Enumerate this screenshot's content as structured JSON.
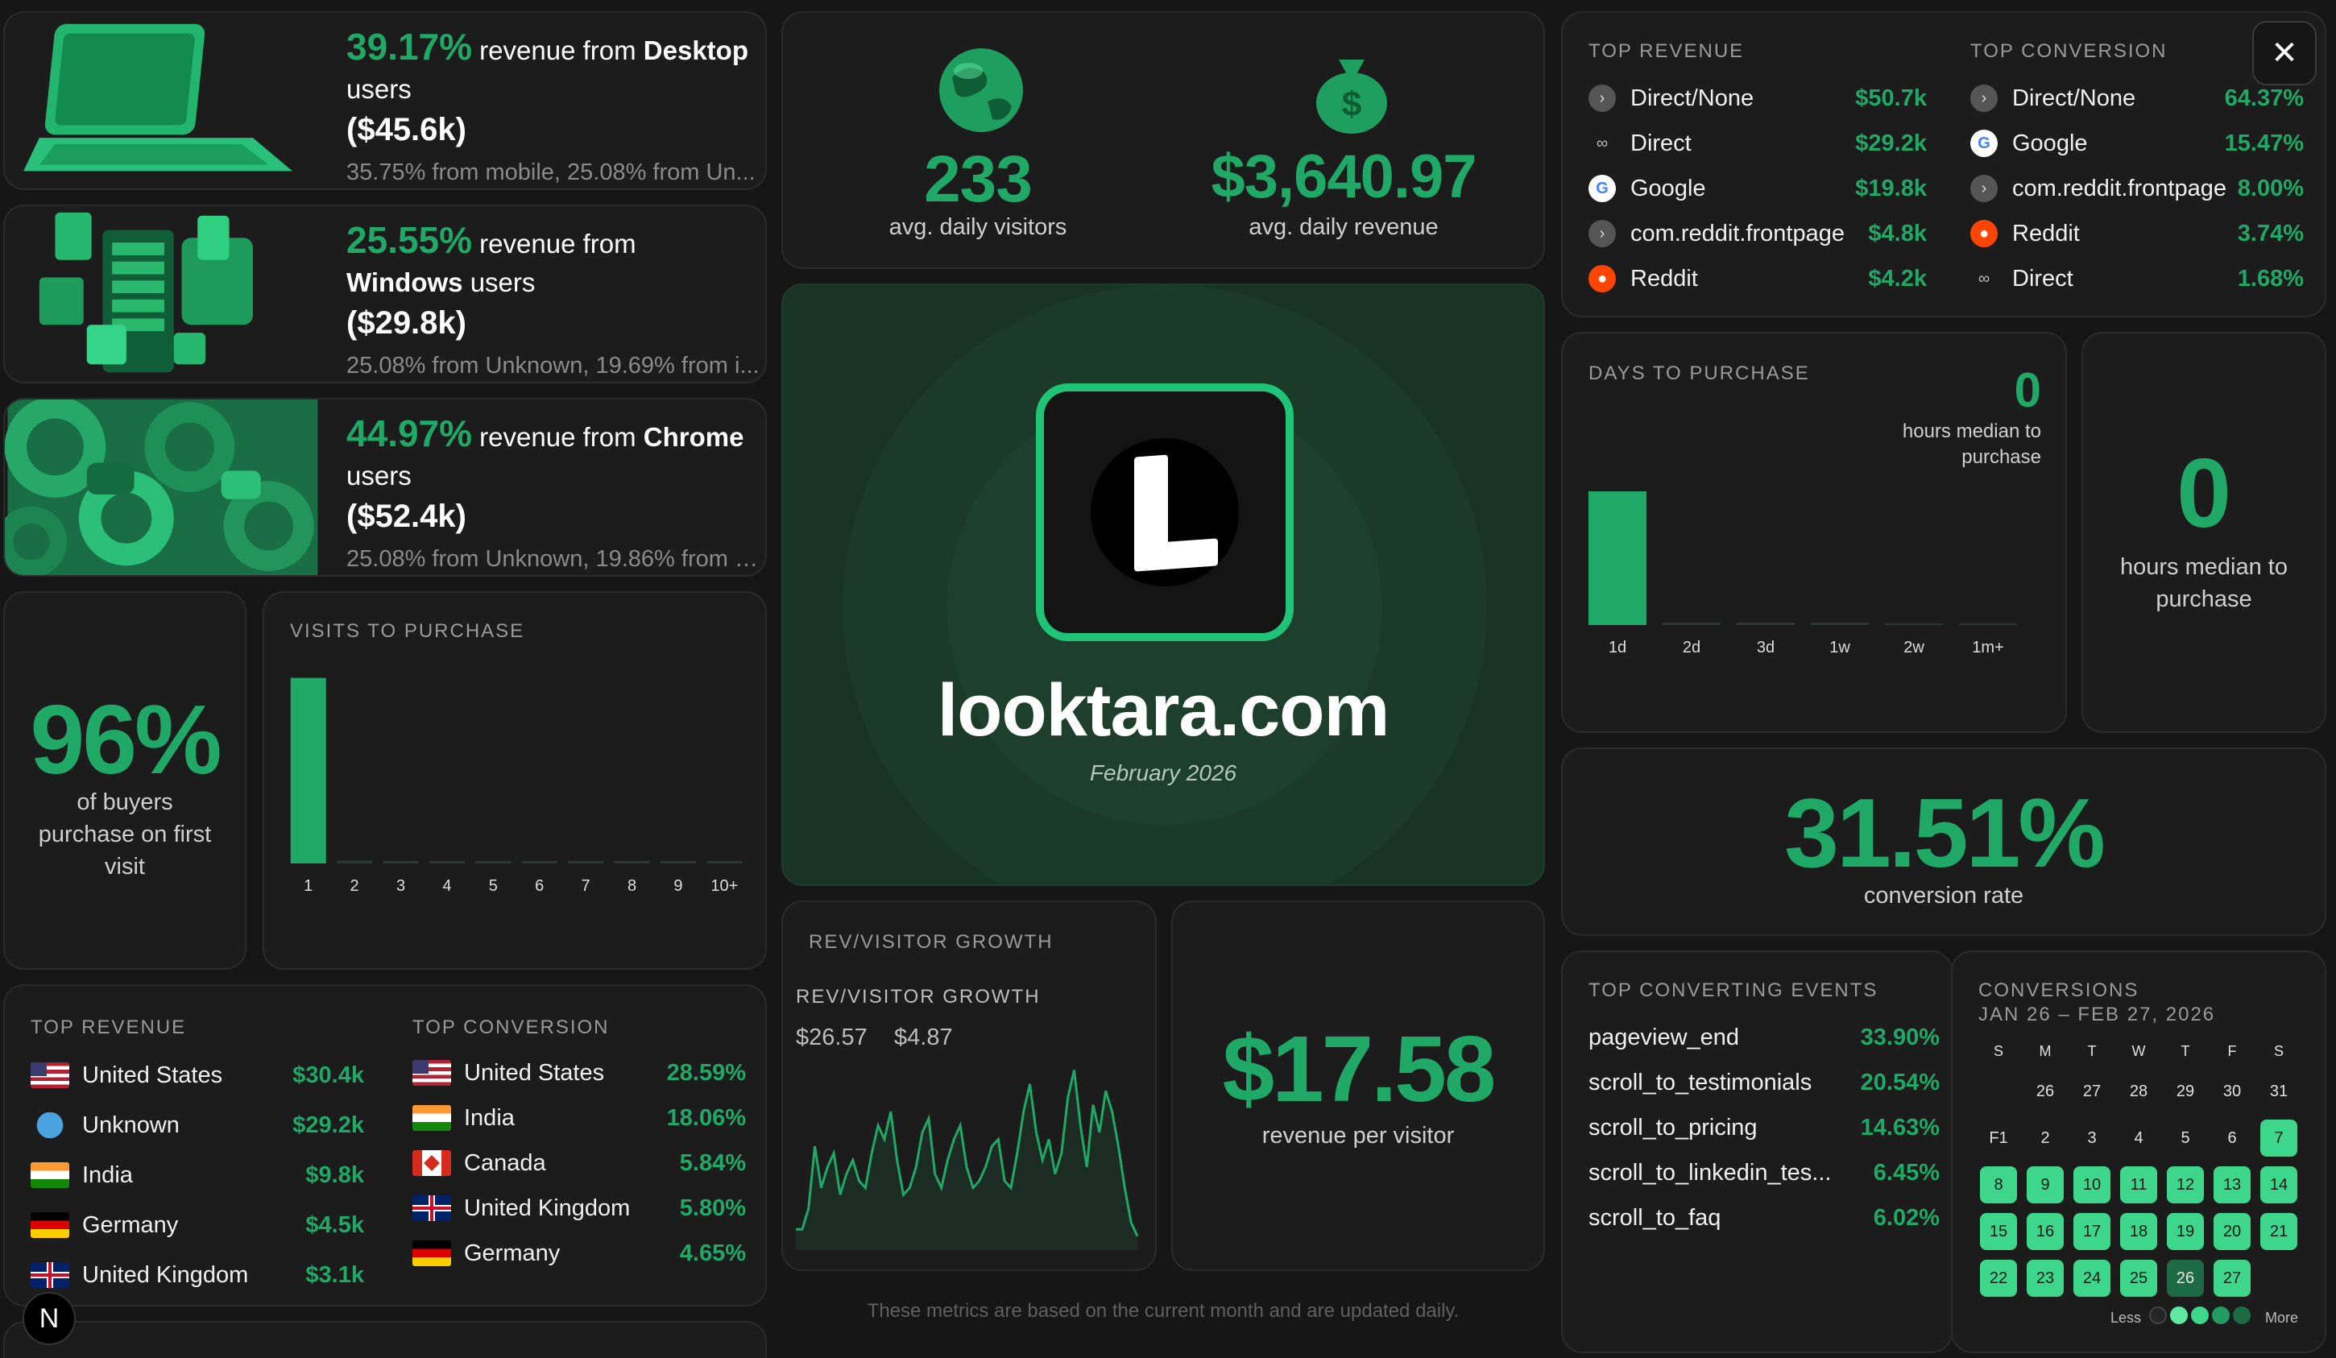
{
  "insights": [
    {
      "pct": "39.17%",
      "pre": " revenue from ",
      "strong": "Desktop",
      "post": " users",
      "amount": "($45.6k)",
      "sub": "35.75% from mobile, 25.08% from Un..."
    },
    {
      "pct": "25.55%",
      "pre": " revenue from ",
      "strong": "Windows",
      "post": " users",
      "amount": "($29.8k)",
      "sub": "25.08% from Unknown, 19.69% from i..."
    },
    {
      "pct": "44.97%",
      "pre": " revenue from ",
      "strong": "Chrome",
      "post": " users",
      "amount": "($52.4k)",
      "sub": "25.08% from Unknown, 19.86% from s..."
    }
  ],
  "stats": {
    "visitors_value": "233",
    "visitors_label": "avg. daily visitors",
    "revenue_value": "$3,640.97",
    "revenue_label": "avg. daily revenue"
  },
  "hero": {
    "domain": "looktara.com",
    "period": "February 2026"
  },
  "sources": {
    "rev_title": "TOP REVENUE",
    "conv_title": "TOP CONVERSION",
    "revenue": [
      {
        "icon": "direct-icon",
        "name": "Direct/None",
        "value": "$50.7k"
      },
      {
        "icon": "link-icon",
        "name": "Direct",
        "value": "$29.2k"
      },
      {
        "icon": "google-icon",
        "name": "Google",
        "value": "$19.8k"
      },
      {
        "icon": "direct-icon",
        "name": "com.reddit.frontpage",
        "value": "$4.8k"
      },
      {
        "icon": "reddit-icon",
        "name": "Reddit",
        "value": "$4.2k"
      }
    ],
    "conversion": [
      {
        "icon": "direct-icon",
        "name": "Direct/None",
        "value": "64.37%"
      },
      {
        "icon": "google-icon",
        "name": "Google",
        "value": "15.47%"
      },
      {
        "icon": "direct-icon",
        "name": "com.reddit.frontpage",
        "value": "8.00%"
      },
      {
        "icon": "reddit-icon",
        "name": "Reddit",
        "value": "3.74%"
      },
      {
        "icon": "link-icon",
        "name": "Direct",
        "value": "1.68%"
      }
    ]
  },
  "days": {
    "title": "DAYS TO PURCHASE",
    "value": "0",
    "caption": "hours median to purchase"
  },
  "hours_card": {
    "value": "0",
    "caption": "hours median to purchase"
  },
  "conversion_rate": {
    "value": "31.51%",
    "label": "conversion rate"
  },
  "first_visit": {
    "value": "96%",
    "label": "of buyers purchase on first visit"
  },
  "visits": {
    "title": "VISITS TO PURCHASE"
  },
  "countries": {
    "rev_title": "TOP REVENUE",
    "conv_title": "TOP CONVERSION",
    "revenue": [
      {
        "flag": "us",
        "name": "United States",
        "value": "$30.4k"
      },
      {
        "flag": "globe",
        "name": "Unknown",
        "value": "$29.2k"
      },
      {
        "flag": "in",
        "name": "India",
        "value": "$9.8k"
      },
      {
        "flag": "de",
        "name": "Germany",
        "value": "$4.5k"
      },
      {
        "flag": "uk",
        "name": "United Kingdom",
        "value": "$3.1k"
      }
    ],
    "conversion": [
      {
        "flag": "us",
        "name": "United States",
        "value": "28.59%"
      },
      {
        "flag": "in",
        "name": "India",
        "value": "18.06%"
      },
      {
        "flag": "ca",
        "name": "Canada",
        "value": "5.84%"
      },
      {
        "flag": "uk",
        "name": "United Kingdom",
        "value": "5.80%"
      },
      {
        "flag": "de",
        "name": "Germany",
        "value": "4.65%"
      }
    ]
  },
  "growth": {
    "title": "REV/VISITOR GROWTH",
    "inner_title": "REV/VISITOR GROWTH",
    "v1": "$26.57",
    "v2": "$4.87"
  },
  "rpv": {
    "value": "$17.58",
    "label": "revenue per visitor"
  },
  "events": {
    "title": "TOP CONVERTING EVENTS",
    "items": [
      {
        "name": "pageview_end",
        "value": "33.90%"
      },
      {
        "name": "scroll_to_testimonials",
        "value": "20.54%"
      },
      {
        "name": "scroll_to_pricing",
        "value": "14.63%"
      },
      {
        "name": "scroll_to_linkedin_tes...",
        "value": "6.45%"
      },
      {
        "name": "scroll_to_faq",
        "value": "6.02%"
      }
    ]
  },
  "calendar": {
    "title": "CONVERSIONS",
    "range": "JAN 26 – FEB 27, 2026",
    "weekdays": [
      "S",
      "M",
      "T",
      "W",
      "T",
      "F",
      "S"
    ],
    "legend_less": "Less",
    "legend_more": "More"
  },
  "footer_note": "These metrics are based on the current month and are updated daily.",
  "close_label": "✕",
  "badge_letter": "N",
  "colors": {
    "accent": "#1fa866",
    "bg": "#161616",
    "card": "#1c1c1c",
    "hero": "#183524"
  },
  "chart_data": [
    {
      "type": "bar",
      "title": "VISITS TO PURCHASE",
      "categories": [
        "1",
        "2",
        "3",
        "4",
        "5",
        "6",
        "7",
        "8",
        "9",
        "10+"
      ],
      "values": [
        96,
        1.5,
        0.5,
        0.5,
        0.5,
        0.3,
        0.3,
        0.3,
        0.3,
        0.3
      ],
      "ylim": [
        0,
        100
      ]
    },
    {
      "type": "bar",
      "title": "DAYS TO PURCHASE",
      "categories": [
        "1d",
        "2d",
        "3d",
        "1w",
        "2w",
        "1m+"
      ],
      "values": [
        100,
        1.5,
        1.5,
        1.5,
        0,
        0
      ],
      "ylim": [
        0,
        100
      ]
    },
    {
      "type": "line",
      "title": "REV/VISITOR GROWTH",
      "x": [
        1,
        2,
        3,
        4,
        5,
        6,
        7,
        8,
        9,
        10,
        11,
        12,
        13,
        14,
        15,
        16,
        17,
        18,
        19,
        20,
        21,
        22,
        23,
        24,
        25,
        26,
        27,
        28,
        29,
        30,
        31,
        32,
        33,
        34,
        35,
        36,
        37,
        38,
        39,
        40,
        41,
        42,
        43,
        44,
        45,
        46,
        47,
        48,
        49,
        50,
        51,
        52,
        53,
        54,
        55
      ],
      "values": [
        3,
        3,
        6,
        15,
        9,
        12,
        14,
        8,
        11,
        13,
        10,
        9,
        14,
        18,
        16,
        20,
        13,
        8,
        9,
        12,
        17,
        19,
        11,
        9,
        13,
        16,
        18,
        12,
        9,
        10,
        12,
        15,
        16,
        10,
        9,
        14,
        20,
        24,
        17,
        13,
        16,
        11,
        14,
        22,
        26,
        18,
        12,
        21,
        17,
        23,
        20,
        15,
        9,
        4,
        2
      ],
      "ylim": [
        0,
        27
      ]
    },
    {
      "type": "heatmap",
      "title": "CONVERSIONS",
      "days": [
        {
          "label": "26",
          "level": 0
        },
        {
          "label": "27",
          "level": 0
        },
        {
          "label": "28",
          "level": 0
        },
        {
          "label": "29",
          "level": 0
        },
        {
          "label": "30",
          "level": 0
        },
        {
          "label": "31",
          "level": 0
        },
        {
          "label": "F1",
          "level": 0
        },
        {
          "label": "2",
          "level": 0
        },
        {
          "label": "3",
          "level": 0
        },
        {
          "label": "4",
          "level": 0
        },
        {
          "label": "5",
          "level": 0
        },
        {
          "label": "6",
          "level": 0
        },
        {
          "label": "7",
          "level": 2
        },
        {
          "label": "8",
          "level": 2
        },
        {
          "label": "9",
          "level": 2
        },
        {
          "label": "10",
          "level": 2
        },
        {
          "label": "11",
          "level": 2
        },
        {
          "label": "12",
          "level": 2
        },
        {
          "label": "13",
          "level": 2
        },
        {
          "label": "14",
          "level": 2
        },
        {
          "label": "15",
          "level": 2
        },
        {
          "label": "16",
          "level": 2
        },
        {
          "label": "17",
          "level": 2
        },
        {
          "label": "18",
          "level": 2
        },
        {
          "label": "19",
          "level": 2
        },
        {
          "label": "20",
          "level": 2
        },
        {
          "label": "21",
          "level": 2
        },
        {
          "label": "22",
          "level": 2
        },
        {
          "label": "23",
          "level": 2
        },
        {
          "label": "24",
          "level": 2
        },
        {
          "label": "25",
          "level": 2
        },
        {
          "label": "26",
          "level": 4
        },
        {
          "label": "27",
          "level": 2
        }
      ]
    }
  ]
}
